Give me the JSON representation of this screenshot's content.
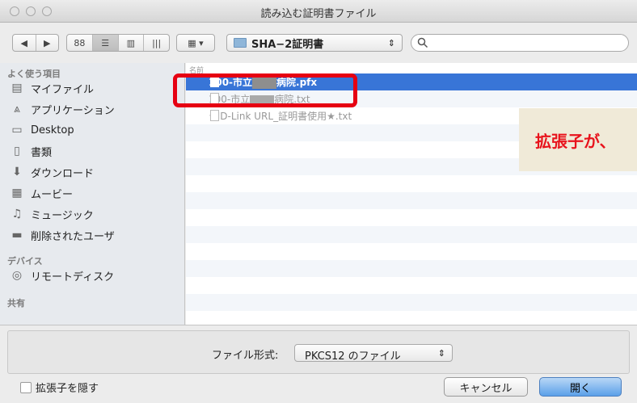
{
  "window": {
    "title": "読み込む証明書ファイル"
  },
  "toolbar": {
    "back_glyph": "◀",
    "forward_glyph": "▶",
    "view_icons": [
      "88",
      "☰",
      "▥",
      "|||"
    ],
    "arrange_glyph": "▦ ▾",
    "location": "SHA−2証明書",
    "location_arrows": "⇕",
    "search_placeholder": ""
  },
  "sidebar": {
    "favorites_header": "よく使う項目",
    "favorites": [
      {
        "label": "マイファイル",
        "icon": "▤"
      },
      {
        "label": "アプリケーション",
        "icon": "⩓"
      },
      {
        "label": "Desktop",
        "icon": "▭"
      },
      {
        "label": "書類",
        "icon": "▯"
      },
      {
        "label": "ダウンロード",
        "icon": "⬇"
      },
      {
        "label": "ムービー",
        "icon": "▦"
      },
      {
        "label": "ミュージック",
        "icon": "♫"
      },
      {
        "label": "削除されたユーザ",
        "icon": "▬"
      }
    ],
    "devices_header": "デバイス",
    "devices": [
      {
        "label": "リモートディスク",
        "icon": "◎"
      }
    ],
    "shared_header": "共有"
  },
  "file_list": {
    "header": "名前",
    "files": [
      {
        "prefix": "100-市立",
        "suffix": "病院.pfx",
        "selected": true
      },
      {
        "prefix": "100-市立",
        "suffix": "病院.txt",
        "selected": false
      },
      {
        "prefix": "★ID-Link URL_証明書使用★.txt",
        "suffix": "",
        "selected": false
      }
    ]
  },
  "callout": {
    "text": "拡張子が、"
  },
  "footer": {
    "format_label": "ファイル形式:",
    "format_value": "PKCS12 のファイル",
    "hide_extension_label": "拡張子を隠す",
    "cancel_label": "キャンセル",
    "open_label": "開く"
  },
  "colors": {
    "selection": "#3875d7",
    "highlight": "#e60012",
    "callout_text": "#e8131c"
  }
}
